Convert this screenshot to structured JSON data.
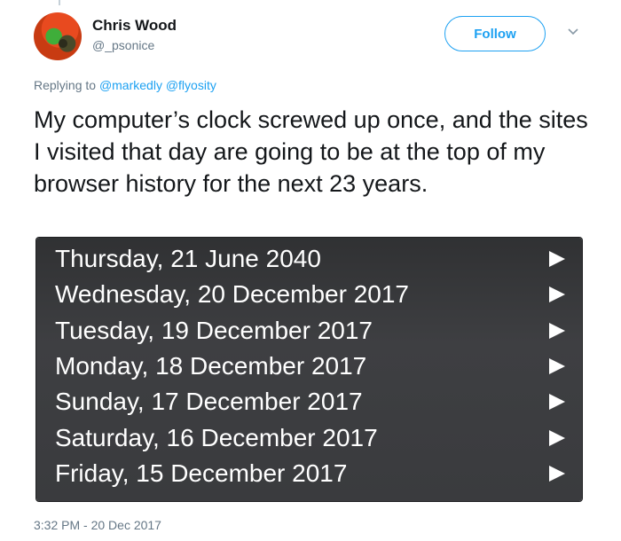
{
  "author": {
    "name": "Chris Wood",
    "handle": "@_psonice"
  },
  "follow_button": "Follow",
  "reply": {
    "prefix": "Replying to",
    "mentions": "@markedly @flyosity"
  },
  "tweet_text": "My computer’s clock screwed up once, and the sites I visited that day are going to be at the top of my browser history for the next 23 years.",
  "history": {
    "items": [
      {
        "label": "Thursday, 21 June 2040"
      },
      {
        "label": "Wednesday, 20 December 2017"
      },
      {
        "label": "Tuesday, 19 December 2017"
      },
      {
        "label": "Monday, 18 December 2017"
      },
      {
        "label": "Sunday, 17 December 2017"
      },
      {
        "label": "Saturday, 16 December 2017"
      },
      {
        "label": "Friday, 15 December 2017"
      }
    ]
  },
  "timestamp": "3:32 PM - 20 Dec 2017",
  "colors": {
    "accent": "#1da1f2",
    "secondary_text": "#657786",
    "panel_background": "#3a3b3e"
  },
  "icons": {
    "caret": "chevron-down-icon",
    "history_arrow": "play-triangle-icon"
  }
}
